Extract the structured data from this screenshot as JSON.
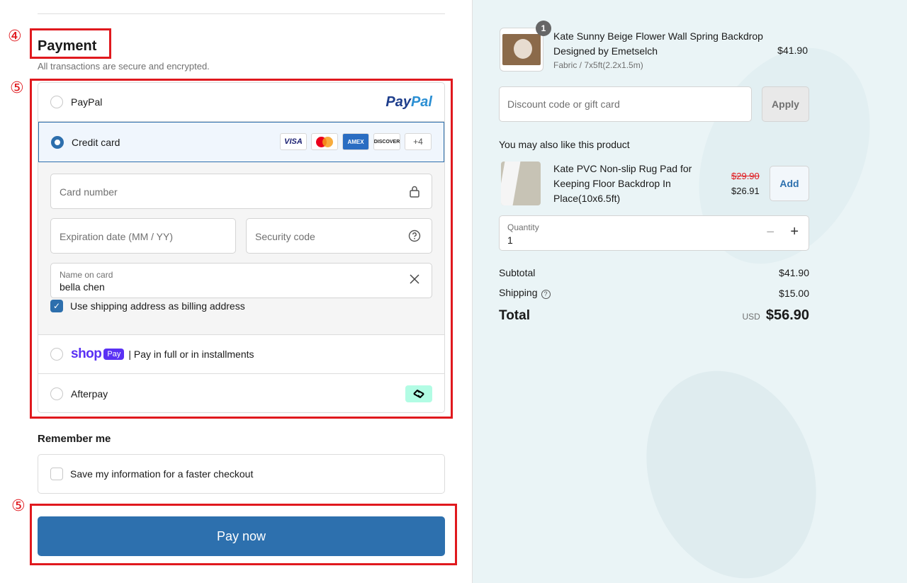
{
  "annotations": {
    "step4": "④",
    "step5a": "⑤",
    "step5b": "⑤"
  },
  "payment": {
    "title": "Payment",
    "subtitle": "All transactions are secure and encrypted.",
    "paypal": {
      "label": "PayPal",
      "logo_a": "Pay",
      "logo_b": "Pal"
    },
    "credit": {
      "label": "Credit card",
      "logos": {
        "visa": "VISA",
        "amex": "AMEX",
        "discover": "DISCOVER",
        "more": "+4"
      },
      "card_number_placeholder": "Card number",
      "expiration_placeholder": "Expiration date (MM / YY)",
      "security_placeholder": "Security code",
      "name_label": "Name on card",
      "name_value": "bella chen",
      "billing_checkbox_label": "Use shipping address as billing address"
    },
    "shop": {
      "word": "shop",
      "badge": "Pay",
      "label": "| Pay in full or in installments"
    },
    "afterpay": {
      "label": "Afterpay"
    }
  },
  "remember": {
    "title": "Remember me",
    "checkbox_label": "Save my information for a faster checkout"
  },
  "pay_button": "Pay now",
  "summary": {
    "product": {
      "quantity_badge": "1",
      "title": "Kate Sunny Beige Flower Wall Spring Backdrop Designed by Emetselch",
      "variant": "Fabric / 7x5ft(2.2x1.5m)",
      "price": "$41.90"
    },
    "discount_placeholder": "Discount code or gift card",
    "apply_label": "Apply",
    "also_like_title": "You may also like this product",
    "recommend": {
      "title": "Kate PVC Non-slip Rug Pad for Keeping Floor Backdrop In Place(10x6.5ft)",
      "old_price": "$29.90",
      "new_price": "$26.91",
      "add_label": "Add"
    },
    "quantity": {
      "label": "Quantity",
      "value": "1"
    },
    "subtotal_label": "Subtotal",
    "subtotal_value": "$41.90",
    "shipping_label": "Shipping",
    "shipping_value": "$15.00",
    "total_label": "Total",
    "currency": "USD",
    "total_value": "$56.90"
  },
  "colors": {
    "accent": "#2d70ae",
    "annotation": "#e0191e",
    "shop_purple": "#5a31f4",
    "panel": "#eaf4f6"
  }
}
